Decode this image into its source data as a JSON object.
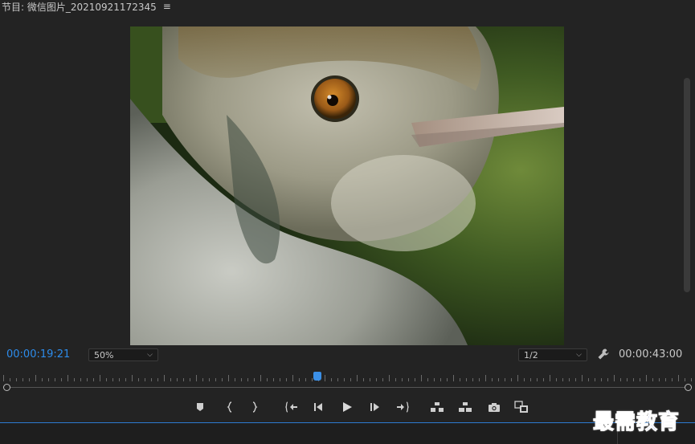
{
  "panel": {
    "title": "节目: 微信图片_20210921172345",
    "menu_icon": "hamburger-icon",
    "menu_glyph": "≡"
  },
  "viewer": {
    "image_description_icon": "bird-closeup-photo"
  },
  "timecode": {
    "current": "00:00:19:21",
    "duration": "00:00:43:00",
    "playhead_fraction": 0.456
  },
  "zoom": {
    "value": "50%",
    "chevron": "⌵"
  },
  "resolution": {
    "value": "1/2",
    "chevron": "⌵"
  },
  "controls": {
    "buttons": [
      {
        "name": "add-marker-button",
        "icon": "marker-icon"
      },
      {
        "name": "mark-in-button",
        "icon": "mark-in-icon"
      },
      {
        "name": "mark-out-button",
        "icon": "mark-out-icon"
      },
      {
        "name": "go-to-in-button",
        "icon": "go-to-in-icon"
      },
      {
        "name": "step-back-button",
        "icon": "step-back-icon"
      },
      {
        "name": "play-button",
        "icon": "play-icon"
      },
      {
        "name": "step-forward-button",
        "icon": "step-forward-icon"
      },
      {
        "name": "go-to-out-button",
        "icon": "go-to-out-icon"
      },
      {
        "name": "lift-button",
        "icon": "lift-icon"
      },
      {
        "name": "extract-button",
        "icon": "extract-icon"
      },
      {
        "name": "export-frame-button",
        "icon": "camera-icon"
      },
      {
        "name": "compare-view-button",
        "icon": "compare-icon"
      }
    ]
  },
  "watermark": {
    "text": "最需教育"
  },
  "colors": {
    "accent": "#2d8ceb",
    "background": "#232323",
    "playhead": "#3b8fe6"
  }
}
